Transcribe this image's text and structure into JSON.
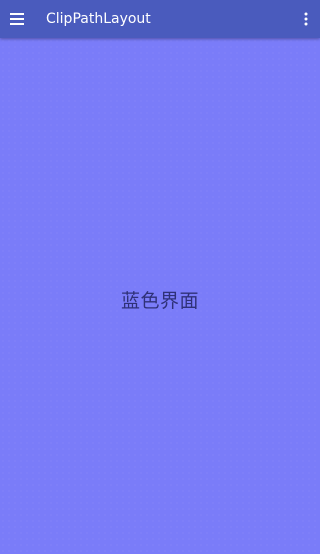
{
  "appbar": {
    "title": "ClipPathLayout",
    "menu_icon": "hamburger-menu-icon",
    "overflow_icon": "more-vert-icon",
    "color": "#4a5bbd"
  },
  "content": {
    "center_text": "蓝色界面",
    "background_color": "#7a7cf9"
  }
}
